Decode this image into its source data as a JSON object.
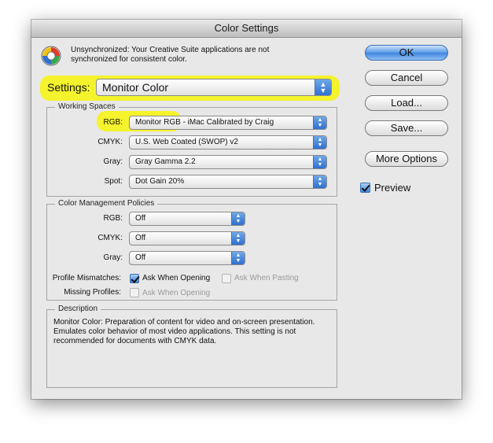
{
  "window": {
    "title": "Color Settings"
  },
  "warning": {
    "text": "Unsynchronized: Your Creative Suite applications are not synchronized for consistent color."
  },
  "settings": {
    "label": "Settings:",
    "value": "Monitor Color"
  },
  "working_spaces": {
    "title": "Working Spaces",
    "rows": [
      {
        "label": "RGB:",
        "value": "Monitor RGB - iMac Calibrated by Craig"
      },
      {
        "label": "CMYK:",
        "value": "U.S. Web Coated (SWOP) v2"
      },
      {
        "label": "Gray:",
        "value": "Gray Gamma 2.2"
      },
      {
        "label": "Spot:",
        "value": "Dot Gain 20%"
      }
    ]
  },
  "policies": {
    "title": "Color Management Policies",
    "rows": [
      {
        "label": "RGB:",
        "value": "Off"
      },
      {
        "label": "CMYK:",
        "value": "Off"
      },
      {
        "label": "Gray:",
        "value": "Off"
      }
    ],
    "profile_mismatches": {
      "label": "Profile Mismatches:",
      "ask_opening": {
        "label": "Ask When Opening",
        "checked": true
      },
      "ask_pasting": {
        "label": "Ask When Pasting",
        "checked": false
      }
    },
    "missing_profiles": {
      "label": "Missing Profiles:",
      "ask_opening": {
        "label": "Ask When Opening",
        "checked": false
      }
    }
  },
  "description": {
    "title": "Description",
    "text": "Monitor Color:  Preparation of content for video and on-screen presentation. Emulates color behavior of most video applications. This setting is not recommended for documents with CMYK data."
  },
  "buttons": {
    "ok": "OK",
    "cancel": "Cancel",
    "load": "Load...",
    "save": "Save...",
    "more_options": "More Options"
  },
  "preview": {
    "label": "Preview",
    "checked": true
  },
  "colors": {
    "highlight": "#f5f32b",
    "accent": "#3d84de"
  }
}
